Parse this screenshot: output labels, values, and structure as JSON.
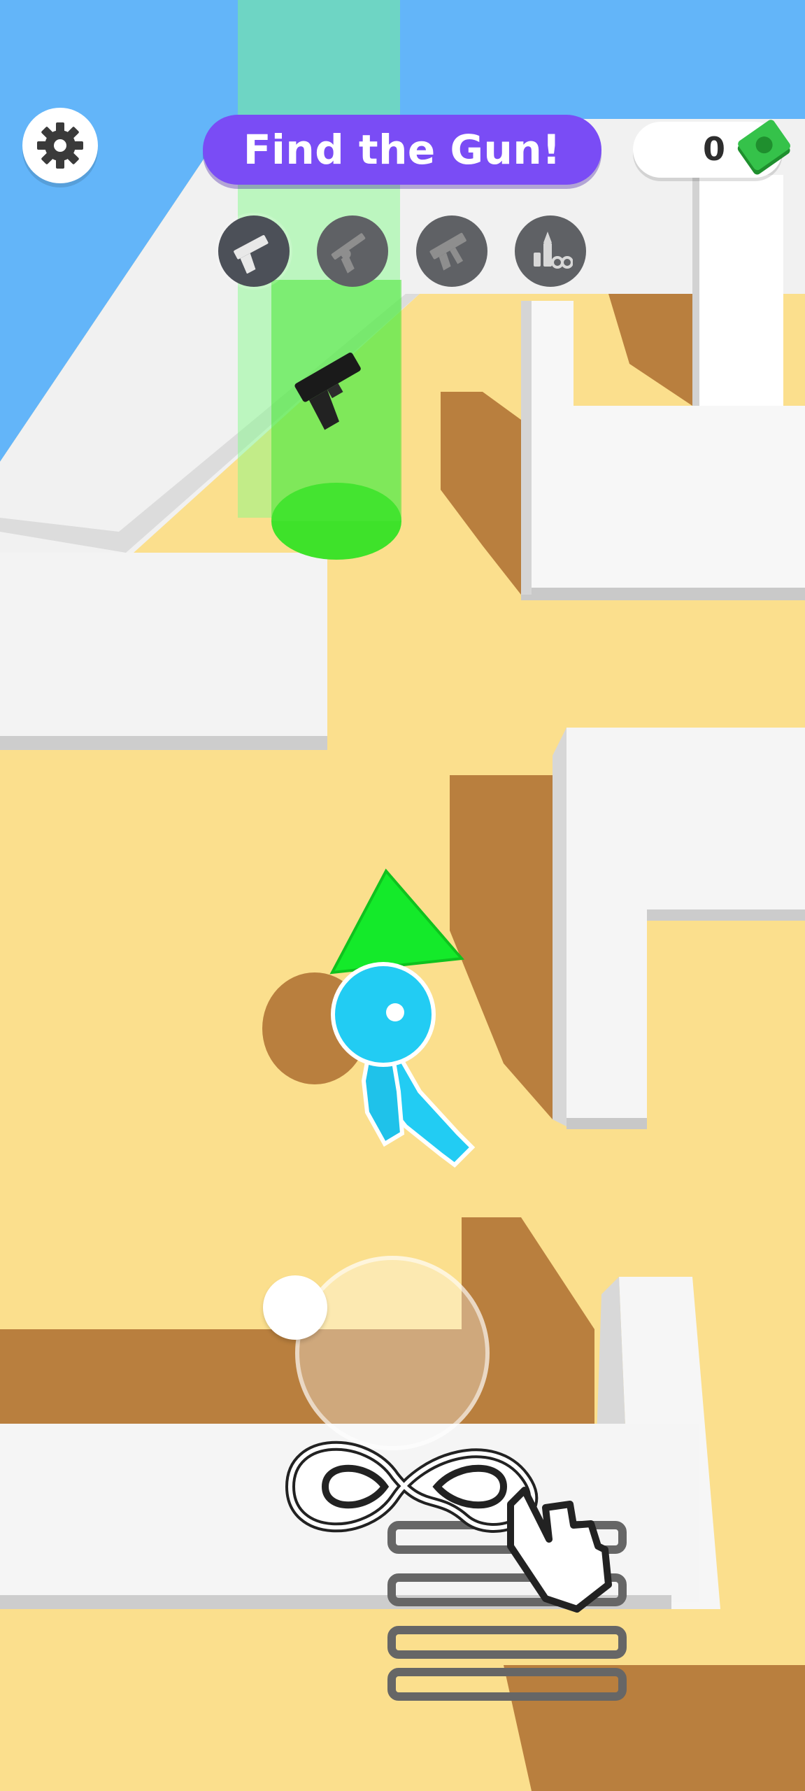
{
  "hud": {
    "title": "Find the Gun!",
    "money": "0",
    "money_icon": "cash-stack-icon",
    "settings_icon": "gear-icon"
  },
  "weapons": [
    {
      "icon": "pistol-icon",
      "state": "selected"
    },
    {
      "icon": "revolver-icon",
      "state": "locked"
    },
    {
      "icon": "smg-icon",
      "state": "locked"
    },
    {
      "icon": "ammo-handcuffs-icon",
      "state": "locked"
    }
  ],
  "controls": {
    "joystick": "virtual-joystick",
    "tutorial_icon": "infinity-swipe-hand-icon"
  },
  "colors": {
    "sky": "#63b5f9",
    "floor": "#fbdf8d",
    "shadow": "#b97f3e",
    "wall": "#f3f3f3",
    "title_pill": "#7a4cf5",
    "player": "#22ccf3",
    "arrow": "#14ea2a",
    "pickup_beam": "#3ee22a"
  }
}
